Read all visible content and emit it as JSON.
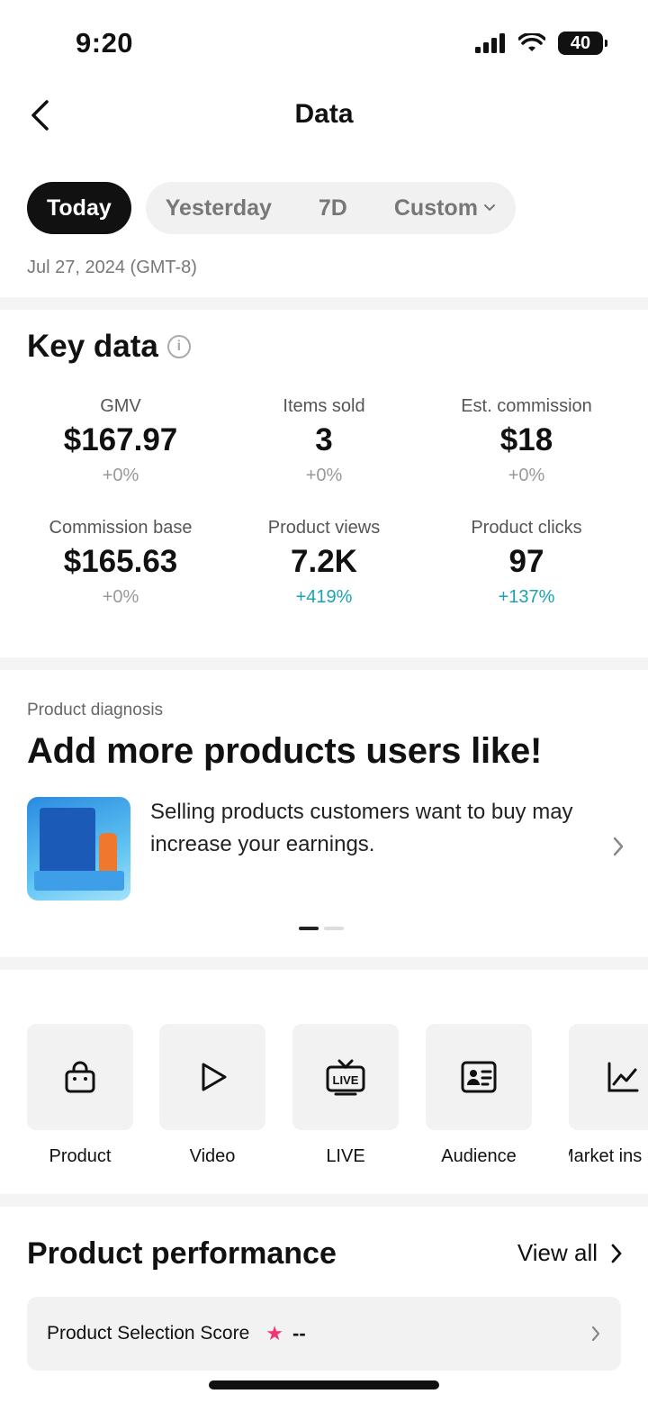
{
  "status_bar": {
    "time": "9:20",
    "battery": "40"
  },
  "header": {
    "title": "Data"
  },
  "tabs": {
    "today": "Today",
    "yesterday": "Yesterday",
    "seven_day": "7D",
    "custom": "Custom"
  },
  "date_label": "Jul 27, 2024 (GMT-8)",
  "key_data": {
    "title": "Key data",
    "info": "i",
    "metrics": [
      {
        "label": "GMV",
        "value": "$167.97",
        "change": "+0%"
      },
      {
        "label": "Items sold",
        "value": "3",
        "change": "+0%"
      },
      {
        "label": "Est. commission",
        "value": "$18",
        "change": "+0%"
      },
      {
        "label": "Commission base",
        "value": "$165.63",
        "change": "+0%"
      },
      {
        "label": "Product views",
        "value": "7.2K",
        "change": "+419%"
      },
      {
        "label": "Product clicks",
        "value": "97",
        "change": "+137%"
      }
    ],
    "accent_up_color": "#1aa3b5"
  },
  "diagnosis": {
    "label": "Product diagnosis",
    "title": "Add more products users like!",
    "text": "Selling products customers want to buy may increase your earnings."
  },
  "shortcuts": [
    {
      "label": "Product",
      "icon": "shopping-bag-icon"
    },
    {
      "label": "Video",
      "icon": "play-icon"
    },
    {
      "label": "LIVE",
      "icon": "live-tv-icon"
    },
    {
      "label": "Audience",
      "icon": "id-card-icon"
    },
    {
      "label": "Market ins",
      "icon": "trend-chart-icon"
    }
  ],
  "performance": {
    "title": "Product performance",
    "view_all": "View all",
    "score_label": "Product Selection Score",
    "score_value": "--",
    "star_color": "#f0346f"
  }
}
